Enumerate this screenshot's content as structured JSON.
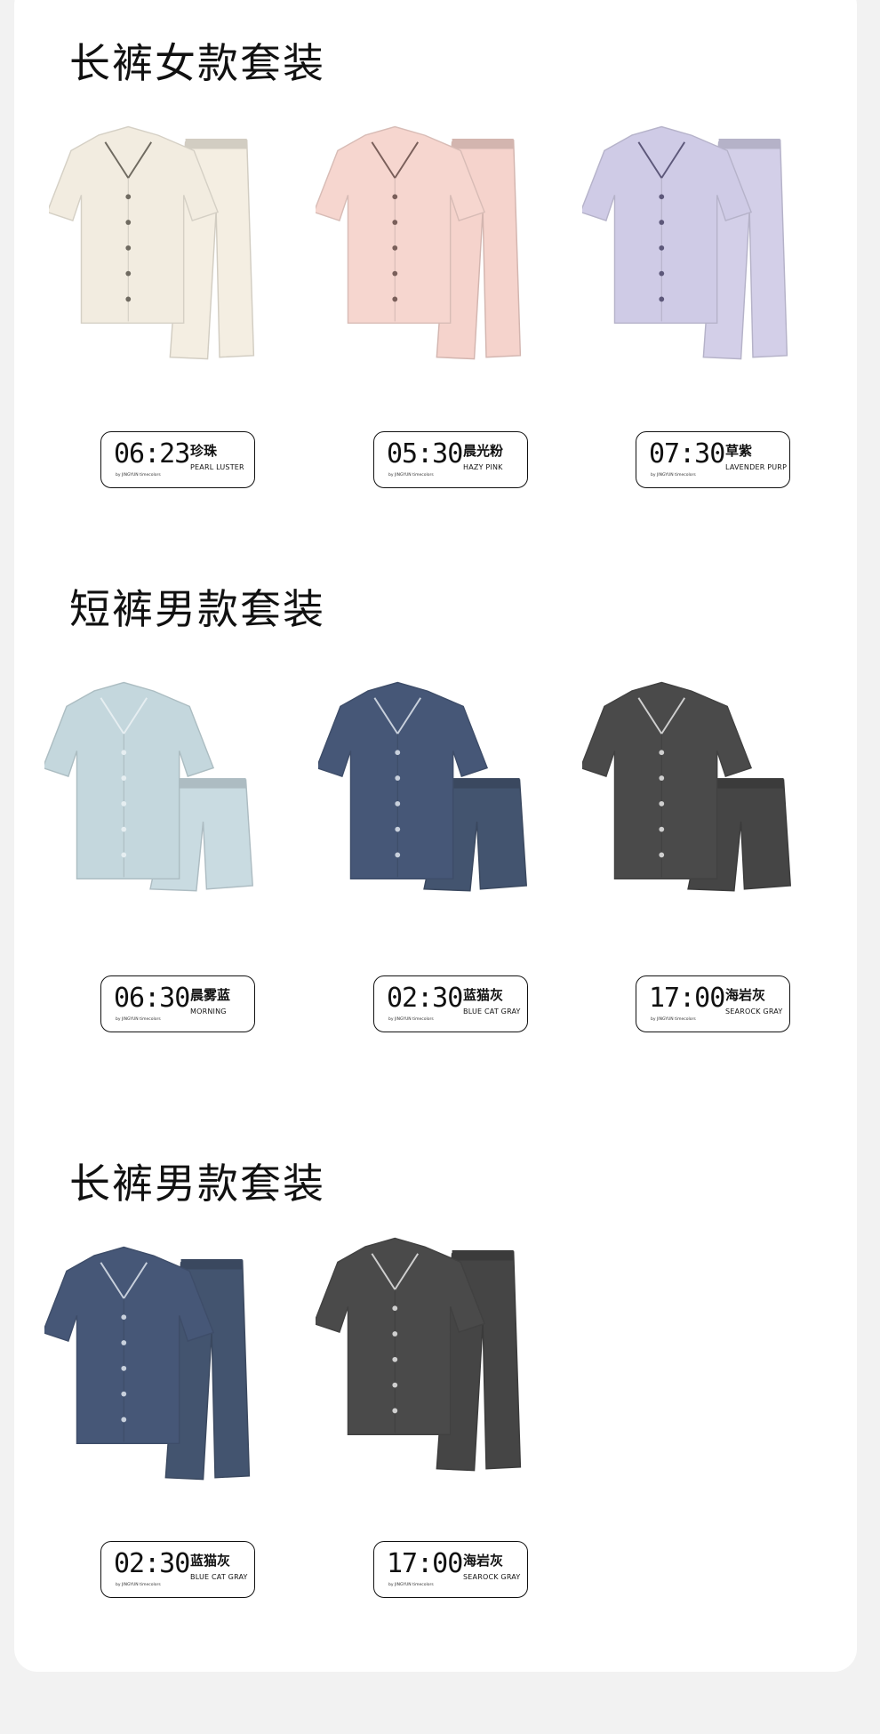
{
  "sections": [
    {
      "title": "长裤女款套装"
    },
    {
      "title": "短裤男款套装"
    },
    {
      "title": "长裤男款套装"
    }
  ],
  "products": [
    {
      "time": "06:23",
      "cn": "珍珠",
      "en": "PEARL LUSTER",
      "shirt": "#f2ece0",
      "pants": "#f4eee2",
      "trim": "#6f6a60",
      "style": "women-long"
    },
    {
      "time": "05:30",
      "cn": "晨光粉",
      "en": "HAZY PINK",
      "shirt": "#f6d6cf",
      "pants": "#f5d3cc",
      "trim": "#7a5f5a",
      "style": "women-long"
    },
    {
      "time": "07:30",
      "cn": "草紫",
      "en": "LAVENDER PURP",
      "shirt": "#cfcbe6",
      "pants": "#d3cfe8",
      "trim": "#5d587a",
      "style": "women-long"
    },
    {
      "time": "06:30",
      "cn": "晨雾蓝",
      "en": "MORNING",
      "shirt": "#c4d7dd",
      "pants": "#c9dbe1",
      "trim": "#e6eef1",
      "style": "men-short"
    },
    {
      "time": "02:30",
      "cn": "蓝猫灰",
      "en": "BLUE CAT GRAY",
      "shirt": "#465777",
      "pants": "#43546f",
      "trim": "#c8d0dc",
      "style": "men-short"
    },
    {
      "time": "17:00",
      "cn": "海岩灰",
      "en": "SEAROCK GRAY",
      "shirt": "#4a4a4a",
      "pants": "#454545",
      "trim": "#cfcfcf",
      "style": "men-short"
    },
    {
      "time": "02:30",
      "cn": "蓝猫灰",
      "en": "BLUE CAT GRAY",
      "shirt": "#465777",
      "pants": "#43546f",
      "trim": "#c8d0dc",
      "style": "men-long"
    },
    {
      "time": "17:00",
      "cn": "海岩灰",
      "en": "SEAROCK GRAY",
      "shirt": "#4a4a4a",
      "pants": "#454545",
      "trim": "#cfcfcf",
      "style": "men-long"
    }
  ],
  "brand_line": "by JINGYUN timecolors"
}
